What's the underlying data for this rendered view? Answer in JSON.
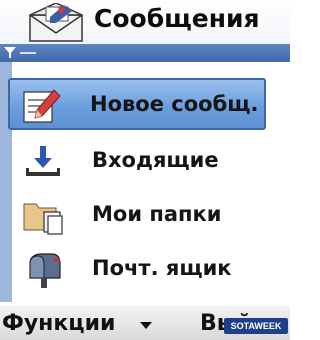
{
  "header": {
    "title": "Сообщения",
    "icon": "envelope-icon"
  },
  "menu": {
    "items": [
      {
        "label": "Новое сообщ.",
        "icon": "new-message-icon",
        "selected": true
      },
      {
        "label": "Входящие",
        "icon": "inbox-icon",
        "selected": false
      },
      {
        "label": "Мои папки",
        "icon": "folders-icon",
        "selected": false
      },
      {
        "label": "Почт. ящик",
        "icon": "mailbox-icon",
        "selected": false
      }
    ]
  },
  "softkeys": {
    "left": "Функции",
    "right": "Выйти"
  },
  "watermark": "SOTAWEEK",
  "colors": {
    "selection": "#6d9fde",
    "bar": "#4a74b6",
    "strip": "#9fb7dc"
  }
}
